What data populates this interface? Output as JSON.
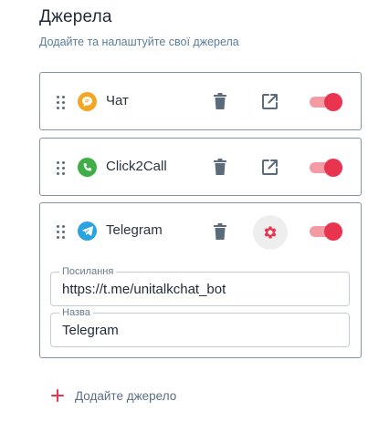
{
  "header": {
    "title": "Джерела",
    "subtitle": "Додайте та налаштуйте свої джерела"
  },
  "colors": {
    "accent": "#e8344e",
    "accent_light": "#f39aa5",
    "chat_icon": "#f5a524",
    "click2call_icon": "#3fae49",
    "telegram_icon": "#2aa3e0"
  },
  "sources": [
    {
      "label": "Чат",
      "icon": "chat-icon",
      "actions": [
        "trash-icon",
        "external-link-icon"
      ],
      "enabled": true
    },
    {
      "label": "Click2Call",
      "icon": "phone-icon",
      "actions": [
        "trash-icon",
        "external-link-icon"
      ],
      "enabled": true
    },
    {
      "label": "Telegram",
      "icon": "telegram-icon",
      "actions": [
        "trash-icon",
        "gear-icon"
      ],
      "enabled": true,
      "fields": [
        {
          "legend": "Посилання",
          "value": "https://t.me/unitalkchat_bot"
        },
        {
          "legend": "Назва",
          "value": "Telegram"
        }
      ]
    }
  ],
  "add_source_label": "Додайте джерело"
}
